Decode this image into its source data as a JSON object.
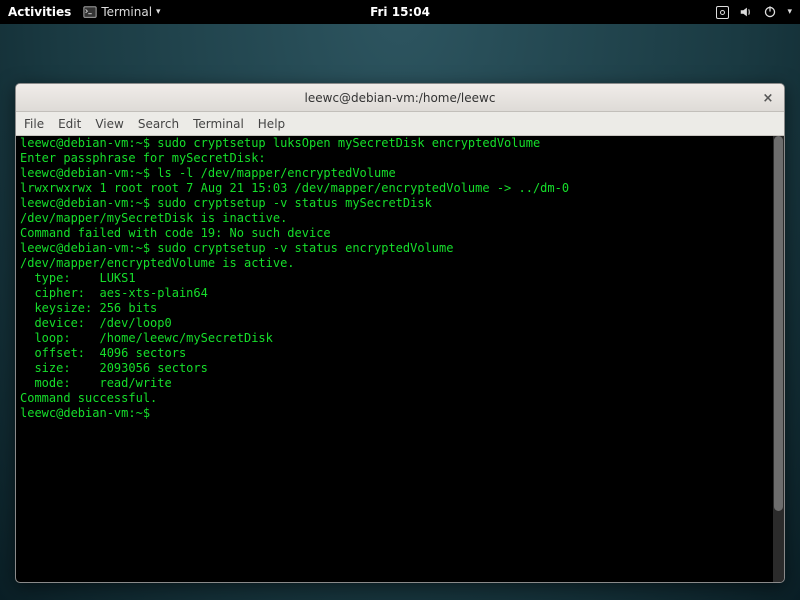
{
  "topbar": {
    "activities": "Activities",
    "app_name": "Terminal",
    "clock": "Fri 15:04"
  },
  "window": {
    "title": "leewc@debian-vm:/home/leewc",
    "menu": [
      "File",
      "Edit",
      "View",
      "Search",
      "Terminal",
      "Help"
    ]
  },
  "terminal": {
    "prompt": "leewc@debian-vm:~$",
    "lines": [
      {
        "p": true,
        "t": " sudo cryptsetup luksOpen mySecretDisk encryptedVolume"
      },
      {
        "p": false,
        "t": "Enter passphrase for mySecretDisk:"
      },
      {
        "p": true,
        "t": " ls -l /dev/mapper/encryptedVolume"
      },
      {
        "p": false,
        "t": "lrwxrwxrwx 1 root root 7 Aug 21 15:03 /dev/mapper/encryptedVolume -> ../dm-0"
      },
      {
        "p": true,
        "t": " sudo cryptsetup -v status mySecretDisk"
      },
      {
        "p": false,
        "t": "/dev/mapper/mySecretDisk is inactive."
      },
      {
        "p": false,
        "t": "Command failed with code 19: No such device"
      },
      {
        "p": true,
        "t": " sudo cryptsetup -v status encryptedVolume"
      },
      {
        "p": false,
        "t": "/dev/mapper/encryptedVolume is active."
      },
      {
        "p": false,
        "t": "  type:    LUKS1"
      },
      {
        "p": false,
        "t": "  cipher:  aes-xts-plain64"
      },
      {
        "p": false,
        "t": "  keysize: 256 bits"
      },
      {
        "p": false,
        "t": "  device:  /dev/loop0"
      },
      {
        "p": false,
        "t": "  loop:    /home/leewc/mySecretDisk"
      },
      {
        "p": false,
        "t": "  offset:  4096 sectors"
      },
      {
        "p": false,
        "t": "  size:    2093056 sectors"
      },
      {
        "p": false,
        "t": "  mode:    read/write"
      },
      {
        "p": false,
        "t": "Command successful."
      },
      {
        "p": true,
        "t": " "
      }
    ]
  }
}
